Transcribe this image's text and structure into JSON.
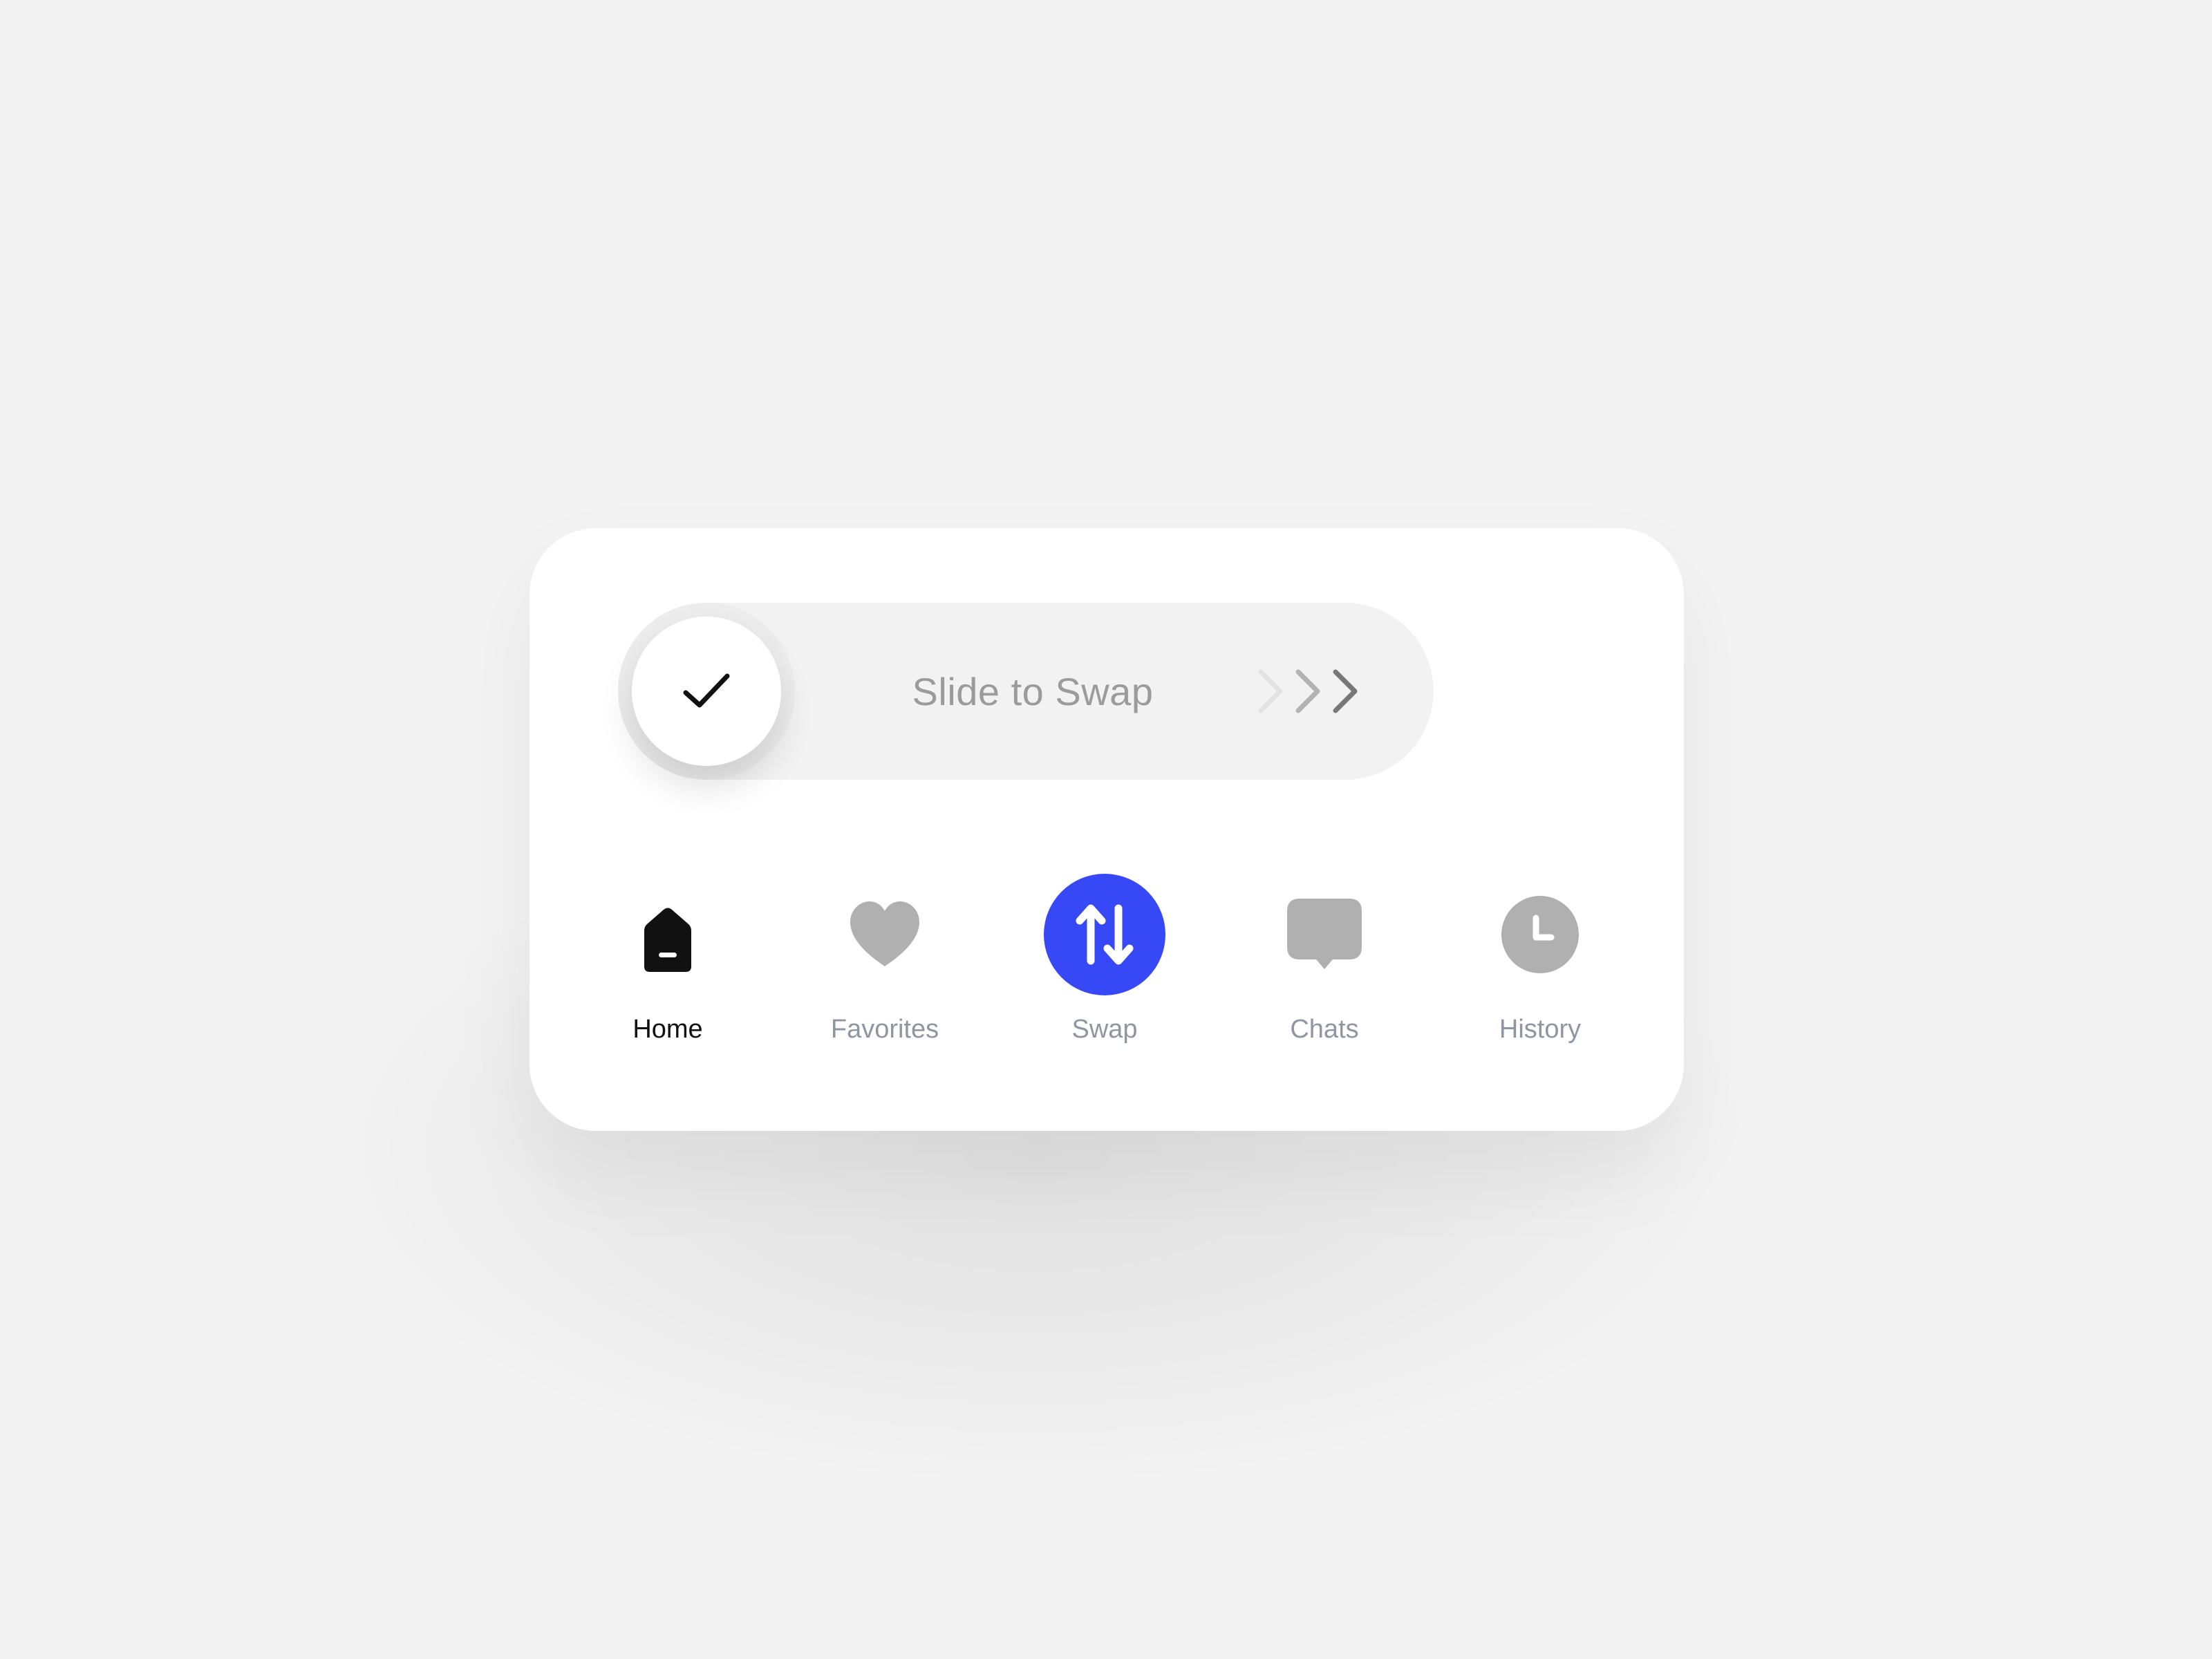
{
  "slider": {
    "label": "Slide to Swap",
    "knob_icon": "check-icon",
    "hint_icon": "triple-chevron-right-icon"
  },
  "nav": {
    "items": [
      {
        "label": "Home",
        "icon": "home-icon",
        "active": true
      },
      {
        "label": "Favorites",
        "icon": "heart-icon",
        "active": false
      },
      {
        "label": "Swap",
        "icon": "swap-arrows-icon",
        "active": false
      },
      {
        "label": "Chats",
        "icon": "chat-bubble-icon",
        "active": false
      },
      {
        "label": "History",
        "icon": "clock-icon",
        "active": false
      }
    ]
  },
  "colors": {
    "background": "#f3f3f3",
    "card": "#ffffff",
    "slider_track": "#f2f2f2",
    "accent": "#3749f7",
    "inactive_icon": "#b0b0b0",
    "inactive_label": "#8e96a2",
    "active": "#111111"
  }
}
